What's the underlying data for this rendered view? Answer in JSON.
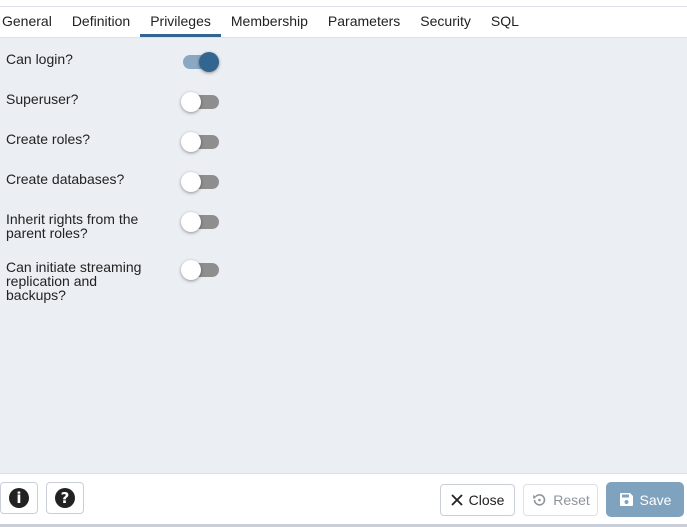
{
  "tabs": [
    {
      "label": "General",
      "active": false
    },
    {
      "label": "Definition",
      "active": false
    },
    {
      "label": "Privileges",
      "active": true
    },
    {
      "label": "Membership",
      "active": false
    },
    {
      "label": "Parameters",
      "active": false
    },
    {
      "label": "Security",
      "active": false
    },
    {
      "label": "SQL",
      "active": false
    }
  ],
  "privileges": [
    {
      "label": "Can login?",
      "value": true
    },
    {
      "label": "Superuser?",
      "value": false
    },
    {
      "label": "Create roles?",
      "value": false
    },
    {
      "label": "Create databases?",
      "value": false
    },
    {
      "label": "Inherit rights from the parent roles?",
      "value": false
    },
    {
      "label": "Can initiate streaming replication and backups?",
      "value": false
    }
  ],
  "footer": {
    "info_icon": "info-circle-icon",
    "help_icon": "question-circle-icon",
    "close_label": "Close",
    "reset_label": "Reset",
    "save_label": "Save"
  },
  "colors": {
    "accent": "#326690",
    "content_bg": "#ebeef3",
    "save_disabled": "#7fa2bf"
  }
}
